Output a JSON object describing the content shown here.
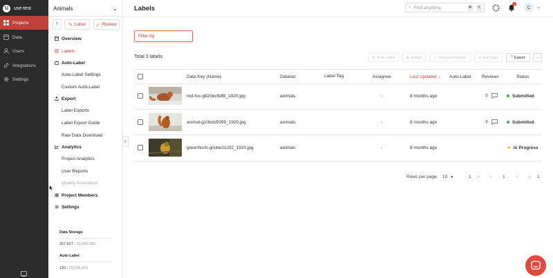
{
  "workspace": {
    "initial": "U",
    "name": "use-test"
  },
  "mainnav": [
    {
      "label": "Projects",
      "icon": "grid-icon",
      "active": true
    },
    {
      "label": "Data",
      "icon": "database-icon"
    },
    {
      "label": "Users",
      "icon": "user-icon"
    },
    {
      "label": "Integrations",
      "icon": "link-icon"
    },
    {
      "label": "Settings",
      "icon": "gear-icon"
    }
  ],
  "project": {
    "title": "Animals",
    "buttons": {
      "label": "Label",
      "review": "Review"
    },
    "menu": {
      "overview": "Overview",
      "labels": "Labels",
      "autolabel": "Auto-Label",
      "autolabel_settings": "Auto-Label Settings",
      "custom_autolabel": "Custom Auto-Label",
      "export": "Export",
      "label_exports": "Label Exports",
      "label_export_guide": "Label Export Guide",
      "raw_data_download": "Raw Data Download",
      "analytics": "Analytics",
      "project_analytics": "Project Analytics",
      "user_reports": "User Reports",
      "quality_assurance": "Quality Assurance",
      "project_members": "Project Members",
      "settings": "Settings"
    },
    "storage": {
      "data_label": "Data Storage",
      "data_used": "257,627",
      "data_max": "/ 20,000,000",
      "auto_label": "Auto-Label",
      "auto_used": "120",
      "auto_max": "/ 20,000,000"
    }
  },
  "header": {
    "title": "Labels",
    "search_placeholder": "Find anything",
    "kbd1": "⌘",
    "kbd2": "K",
    "notification_count": "1",
    "avatar_initial": "C"
  },
  "toolbar": {
    "filter_placeholder": "Filter by",
    "total": "Total 3 labels",
    "auto_label": "Auto-Label",
    "assign": "Assign",
    "request_review": "Request Review",
    "edit_tags": "Edit Tags",
    "export": "Export",
    "more": "···"
  },
  "table": {
    "headers": {
      "data_key": "Data Key (Name)",
      "dataset": "Dataset",
      "label_tag": "Label Tag",
      "assignee": "Assignee",
      "last_updated": "Last Updated ↓",
      "auto_label": "Auto-Label",
      "reviews": "Reviews",
      "status": "Status"
    },
    "rows": [
      {
        "name": "red-fox-g820ec9df8_1920.jpg",
        "dataset": "animals",
        "assignee": "-",
        "updated": "8 months ago",
        "reviews": "2",
        "status": "Submitted",
        "status_color": "#3fae49",
        "thumb": "fox"
      },
      {
        "name": "animal-g10bcb9399_1920.jpg",
        "dataset": "animals",
        "assignee": "-",
        "updated": "8 months ago",
        "reviews": "2",
        "status": "Submitted",
        "status_color": "#3fae49",
        "thumb": "squirrel"
      },
      {
        "name": "greenfinch-g0cbe31c52_1920.jpg",
        "dataset": "animals",
        "assignee": "-",
        "updated": "8 months ago",
        "reviews": "",
        "status": "In Progress",
        "status_color": "#f0b429",
        "thumb": "bird"
      }
    ]
  },
  "pagination": {
    "rows_per_page_label": "Rows per page:",
    "rows_per_page": "10",
    "page_top": "1",
    "first": "|<",
    "prev": "<",
    "current": "1",
    "next": ">",
    "last": ">|",
    "total_pages": "1"
  },
  "colors": {
    "accent": "#c0403a",
    "nav_bg": "#2b2b2b",
    "submitted": "#3fae49",
    "in_progress": "#f0b429"
  }
}
